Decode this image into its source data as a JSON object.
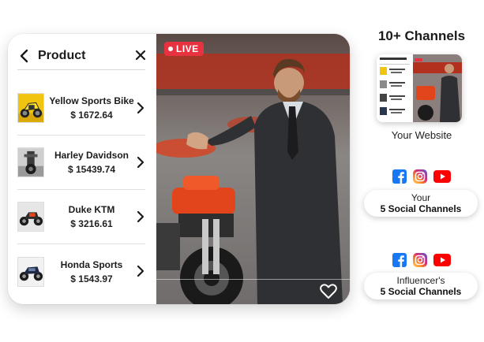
{
  "panel": {
    "title": "Product",
    "products": [
      {
        "name": "Yellow Sports Bike",
        "price": "$ 1672.64"
      },
      {
        "name": "Harley Davidson",
        "price": "$ 15439.74"
      },
      {
        "name": "Duke KTM",
        "price": "$ 3216.61"
      },
      {
        "name": "Honda Sports",
        "price": "$ 1543.97"
      }
    ]
  },
  "video": {
    "live_label": "LIVE"
  },
  "channels": {
    "title": "10+ Channels",
    "website_label": "Your Website",
    "your_social": {
      "line1": "Your",
      "line2": "5 Social Channels"
    },
    "influencer_social": {
      "line1": "Influencer's",
      "line2": "5 Social Channels"
    }
  },
  "icons": [
    "back-arrow-icon",
    "close-icon",
    "chevron-right-icon",
    "heart-icon",
    "facebook-icon",
    "instagram-icon",
    "youtube-icon"
  ],
  "colors": {
    "live_red": "#e9323f",
    "facebook_blue": "#1877f2",
    "youtube_red": "#ff0000",
    "bike_orange": "#e2451c"
  }
}
